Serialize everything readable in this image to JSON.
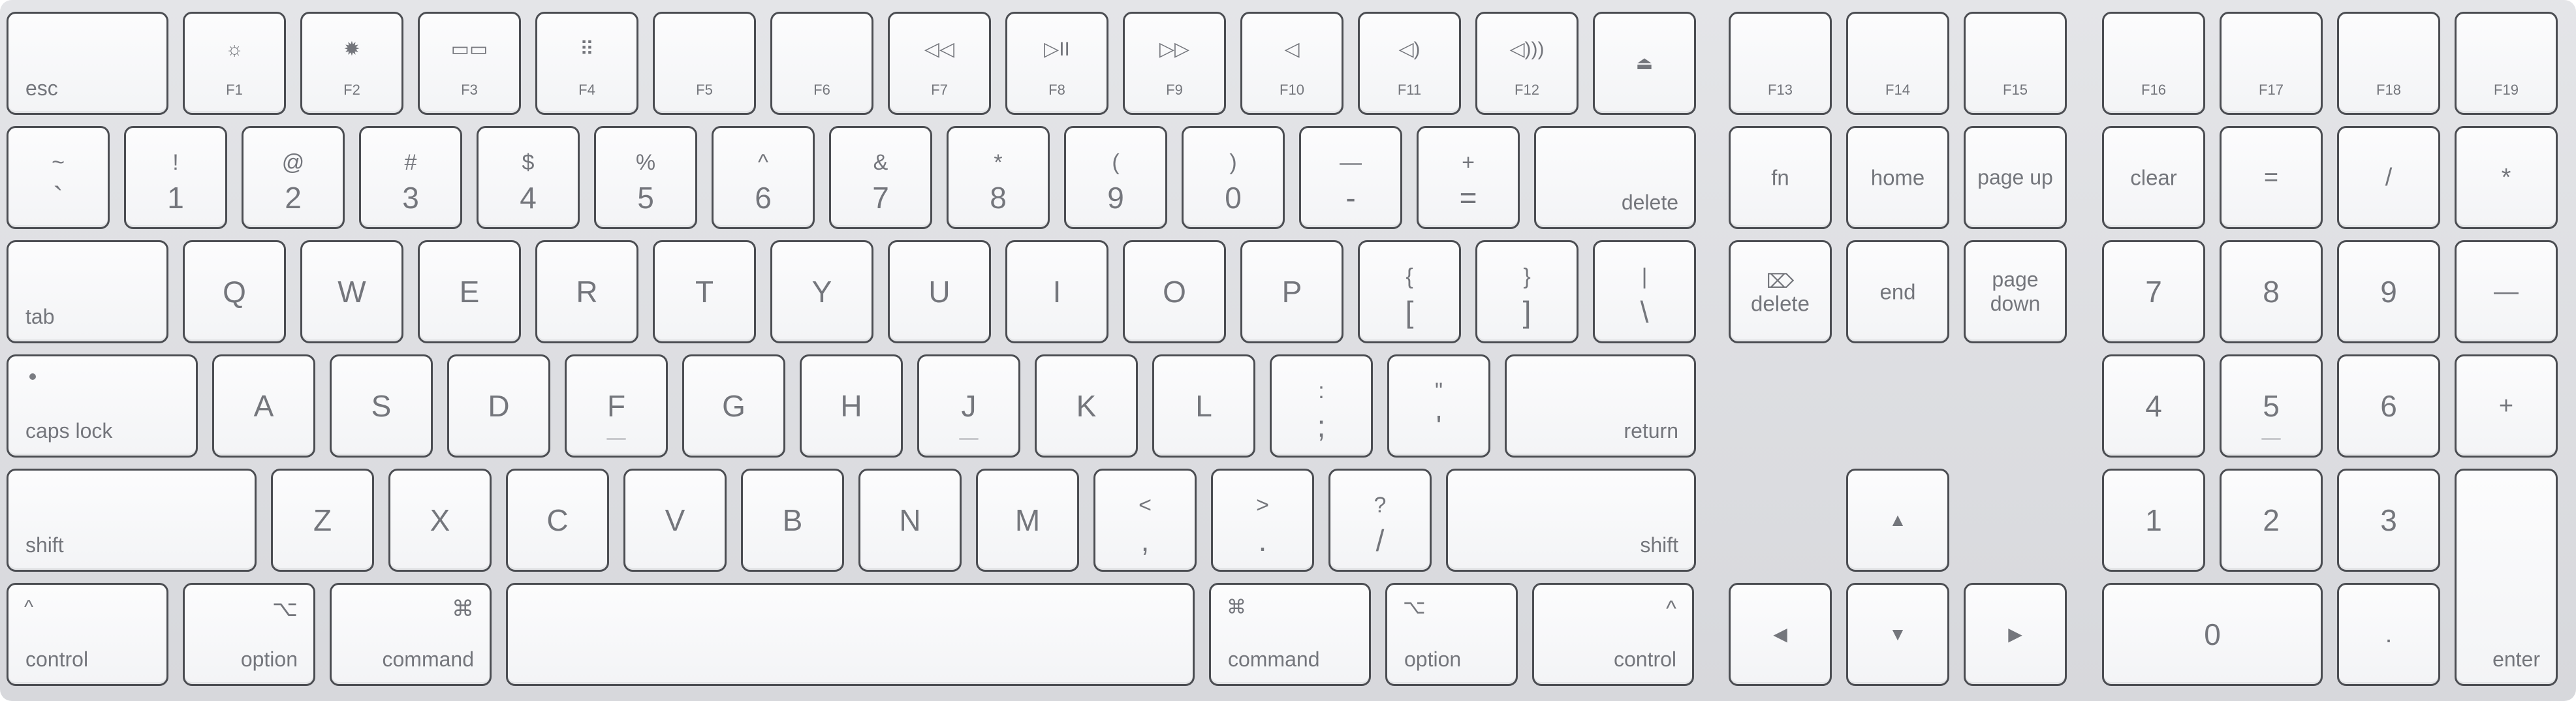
{
  "rows": [
    {
      "name": "function-row",
      "keys": [
        {
          "name": "esc-key",
          "style": "bl",
          "label": "esc"
        },
        {
          "name": "f1-key",
          "style": "fkey",
          "icon": "☼",
          "icon_name": "brightness-down-icon",
          "label": "F1"
        },
        {
          "name": "f2-key",
          "style": "fkey",
          "icon": "✹",
          "icon_name": "brightness-up-icon",
          "label": "F2"
        },
        {
          "name": "f3-key",
          "style": "fkey",
          "icon": "▭▭",
          "icon_name": "mission-control-icon",
          "label": "F3"
        },
        {
          "name": "f4-key",
          "style": "fkey",
          "icon": "⠿",
          "icon_name": "launchpad-icon",
          "label": "F4"
        },
        {
          "name": "f5-key",
          "style": "fkey",
          "icon": "",
          "label": "F5"
        },
        {
          "name": "f6-key",
          "style": "fkey",
          "icon": "",
          "label": "F6"
        },
        {
          "name": "f7-key",
          "style": "fkey",
          "icon": "◁◁",
          "icon_name": "rewind-icon",
          "label": "F7"
        },
        {
          "name": "f8-key",
          "style": "fkey",
          "icon": "▷II",
          "icon_name": "play-pause-icon",
          "label": "F8"
        },
        {
          "name": "f9-key",
          "style": "fkey",
          "icon": "▷▷",
          "icon_name": "fast-forward-icon",
          "label": "F9"
        },
        {
          "name": "f10-key",
          "style": "fkey",
          "icon": "◁",
          "icon_name": "mute-icon",
          "label": "F10"
        },
        {
          "name": "f11-key",
          "style": "fkey",
          "icon": "◁)",
          "icon_name": "volume-down-icon",
          "label": "F11"
        },
        {
          "name": "f12-key",
          "style": "fkey",
          "icon": "◁)))",
          "icon_name": "volume-up-icon",
          "label": "F12"
        },
        {
          "name": "eject-key",
          "style": "icon",
          "icon": "⏏",
          "icon_name": "eject-icon"
        },
        {
          "name": "f13-key",
          "style": "fkey",
          "icon": "",
          "label": "F13"
        },
        {
          "name": "f14-key",
          "style": "fkey",
          "icon": "",
          "label": "F14"
        },
        {
          "name": "f15-key",
          "style": "fkey",
          "icon": "",
          "label": "F15"
        },
        {
          "name": "f16-key",
          "style": "fkey",
          "icon": "",
          "label": "F16"
        },
        {
          "name": "f17-key",
          "style": "fkey",
          "icon": "",
          "label": "F17"
        },
        {
          "name": "f18-key",
          "style": "fkey",
          "icon": "",
          "label": "F18"
        },
        {
          "name": "f19-key",
          "style": "fkey",
          "icon": "",
          "label": "F19"
        }
      ]
    },
    {
      "name": "number-row",
      "keys": [
        {
          "name": "grave-key",
          "style": "dual",
          "upper": "~",
          "lower": "`"
        },
        {
          "name": "1-key",
          "style": "dual",
          "upper": "!",
          "lower": "1"
        },
        {
          "name": "2-key",
          "style": "dual",
          "upper": "@",
          "lower": "2"
        },
        {
          "name": "3-key",
          "style": "dual",
          "upper": "#",
          "lower": "3"
        },
        {
          "name": "4-key",
          "style": "dual",
          "upper": "$",
          "lower": "4"
        },
        {
          "name": "5-key",
          "style": "dual",
          "upper": "%",
          "lower": "5"
        },
        {
          "name": "6-key",
          "style": "dual",
          "upper": "^",
          "lower": "6"
        },
        {
          "name": "7-key",
          "style": "dual",
          "upper": "&",
          "lower": "7"
        },
        {
          "name": "8-key",
          "style": "dual",
          "upper": "*",
          "lower": "8"
        },
        {
          "name": "9-key",
          "style": "dual",
          "upper": "(",
          "lower": "9"
        },
        {
          "name": "0-key",
          "style": "dual",
          "upper": ")",
          "lower": "0"
        },
        {
          "name": "minus-key",
          "style": "dual",
          "upper": "—",
          "lower": "-"
        },
        {
          "name": "equals-key",
          "style": "dual",
          "upper": "+",
          "lower": "="
        },
        {
          "name": "delete-key",
          "style": "br",
          "label": "delete"
        },
        {
          "name": "fn-key",
          "style": "ctr",
          "label": "fn"
        },
        {
          "name": "home-key",
          "style": "ctr",
          "label": "home"
        },
        {
          "name": "page-up-key",
          "style": "dbl",
          "label": "page up"
        },
        {
          "name": "clear-key",
          "style": "ctr",
          "label": "clear"
        },
        {
          "name": "keypad-equals-key",
          "style": "sym",
          "label": "="
        },
        {
          "name": "keypad-divide-key",
          "style": "sym",
          "label": "/"
        },
        {
          "name": "keypad-multiply-key",
          "style": "sym",
          "label": "*"
        }
      ]
    },
    {
      "name": "qwerty-row",
      "keys": [
        {
          "name": "tab-key",
          "style": "bl",
          "label": "tab"
        },
        {
          "name": "q-key",
          "style": "letter",
          "label": "Q"
        },
        {
          "name": "w-key",
          "style": "letter",
          "label": "W"
        },
        {
          "name": "e-key",
          "style": "letter",
          "label": "E"
        },
        {
          "name": "r-key",
          "style": "letter",
          "label": "R"
        },
        {
          "name": "t-key",
          "style": "letter",
          "label": "T"
        },
        {
          "name": "y-key",
          "style": "letter",
          "label": "Y"
        },
        {
          "name": "u-key",
          "style": "letter",
          "label": "U"
        },
        {
          "name": "i-key",
          "style": "letter",
          "label": "I"
        },
        {
          "name": "o-key",
          "style": "letter",
          "label": "O"
        },
        {
          "name": "p-key",
          "style": "letter",
          "label": "P"
        },
        {
          "name": "left-bracket-key",
          "style": "dual",
          "upper": "{",
          "lower": "["
        },
        {
          "name": "right-bracket-key",
          "style": "dual",
          "upper": "}",
          "lower": "]"
        },
        {
          "name": "backslash-key",
          "style": "dual",
          "upper": "|",
          "lower": "\\"
        },
        {
          "name": "forward-delete-key",
          "style": "fwddel",
          "icon": "⌦",
          "icon_name": "forward-delete-icon",
          "label": "delete"
        },
        {
          "name": "end-key",
          "style": "ctr",
          "label": "end"
        },
        {
          "name": "page-down-key",
          "style": "dbl",
          "label": "page down"
        },
        {
          "name": "keypad-7-key",
          "style": "letter",
          "label": "7"
        },
        {
          "name": "keypad-8-key",
          "style": "letter",
          "label": "8"
        },
        {
          "name": "keypad-9-key",
          "style": "letter",
          "label": "9"
        },
        {
          "name": "keypad-minus-key",
          "style": "sym",
          "label": "—"
        }
      ]
    },
    {
      "name": "home-row",
      "keys": [
        {
          "name": "caps-lock-key",
          "style": "caps",
          "label": "caps lock"
        },
        {
          "name": "a-key",
          "style": "letter",
          "label": "A"
        },
        {
          "name": "s-key",
          "style": "letter",
          "label": "S"
        },
        {
          "name": "d-key",
          "style": "letter",
          "label": "D"
        },
        {
          "name": "f-key",
          "style": "letter",
          "label": "F",
          "bump": true
        },
        {
          "name": "g-key",
          "style": "letter",
          "label": "G"
        },
        {
          "name": "h-key",
          "style": "letter",
          "label": "H"
        },
        {
          "name": "j-key",
          "style": "letter",
          "label": "J",
          "bump": true
        },
        {
          "name": "k-key",
          "style": "letter",
          "label": "K"
        },
        {
          "name": "l-key",
          "style": "letter",
          "label": "L"
        },
        {
          "name": "semicolon-key",
          "style": "dual",
          "upper": ":",
          "lower": ";"
        },
        {
          "name": "quote-key",
          "style": "dual",
          "upper": "\"",
          "lower": "'"
        },
        {
          "name": "return-key",
          "style": "br",
          "label": "return"
        },
        {
          "name": "keypad-4-key",
          "style": "letter",
          "label": "4"
        },
        {
          "name": "keypad-5-key",
          "style": "letter",
          "label": "5",
          "bump": true
        },
        {
          "name": "keypad-6-key",
          "style": "letter",
          "label": "6"
        },
        {
          "name": "keypad-plus-key",
          "style": "sym",
          "label": "+"
        }
      ]
    },
    {
      "name": "shift-row",
      "keys": [
        {
          "name": "left-shift-key",
          "style": "bl",
          "label": "shift"
        },
        {
          "name": "z-key",
          "style": "letter",
          "label": "Z"
        },
        {
          "name": "x-key",
          "style": "letter",
          "label": "X"
        },
        {
          "name": "c-key",
          "style": "letter",
          "label": "C"
        },
        {
          "name": "v-key",
          "style": "letter",
          "label": "V"
        },
        {
          "name": "b-key",
          "style": "letter",
          "label": "B"
        },
        {
          "name": "n-key",
          "style": "letter",
          "label": "N"
        },
        {
          "name": "m-key",
          "style": "letter",
          "label": "M"
        },
        {
          "name": "comma-key",
          "style": "dual",
          "upper": "<",
          "lower": ","
        },
        {
          "name": "period-key",
          "style": "dual",
          "upper": ">",
          "lower": "."
        },
        {
          "name": "slash-key",
          "style": "dual",
          "upper": "?",
          "lower": "/"
        },
        {
          "name": "right-shift-key",
          "style": "br",
          "label": "shift"
        },
        {
          "name": "up-arrow-key",
          "style": "icon",
          "icon": "▲",
          "icon_name": "up-arrow-icon"
        },
        {
          "name": "keypad-1-key",
          "style": "letter",
          "label": "1"
        },
        {
          "name": "keypad-2-key",
          "style": "letter",
          "label": "2"
        },
        {
          "name": "keypad-3-key",
          "style": "letter",
          "label": "3"
        },
        {
          "name": "keypad-enter-key",
          "style": "br-center",
          "label": "enter"
        }
      ]
    },
    {
      "name": "bottom-row",
      "keys": [
        {
          "name": "left-control-key",
          "style": "modL",
          "icon": "^",
          "icon_name": "control-icon",
          "label": "control"
        },
        {
          "name": "left-option-key",
          "style": "modR",
          "icon": "⌥",
          "icon_name": "option-icon",
          "label": "option"
        },
        {
          "name": "left-command-key",
          "style": "modR",
          "icon": "⌘",
          "icon_name": "command-icon",
          "label": "command"
        },
        {
          "name": "space-key",
          "style": "blank"
        },
        {
          "name": "right-command-key",
          "style": "modL",
          "icon": "⌘",
          "icon_name": "command-icon",
          "label": "command"
        },
        {
          "name": "right-option-key",
          "style": "modL",
          "icon": "⌥",
          "icon_name": "option-icon",
          "label": "option"
        },
        {
          "name": "right-control-key",
          "style": "modR",
          "icon": "^",
          "icon_name": "control-icon",
          "label": "control"
        },
        {
          "name": "left-arrow-key",
          "style": "icon",
          "icon": "◀",
          "icon_name": "left-arrow-icon"
        },
        {
          "name": "down-arrow-key",
          "style": "icon",
          "icon": "▼",
          "icon_name": "down-arrow-icon"
        },
        {
          "name": "right-arrow-key",
          "style": "icon",
          "icon": "▶",
          "icon_name": "right-arrow-icon"
        },
        {
          "name": "keypad-0-key",
          "style": "letter",
          "label": "0"
        },
        {
          "name": "keypad-decimal-key",
          "style": "sym",
          "label": "."
        }
      ]
    }
  ]
}
